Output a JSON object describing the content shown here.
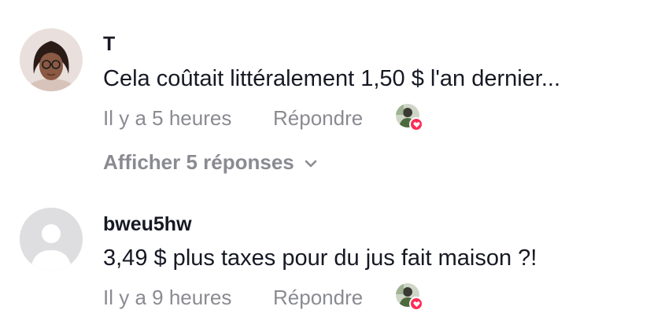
{
  "comments": [
    {
      "username": "T",
      "text": "Cela coûtait littéralement 1,50 $ l'an dernier...",
      "time": "Il y a 5 heures",
      "reply_label": "Répondre",
      "avatar": "photo-avatar",
      "creator_liked": true,
      "view_replies": "Afficher 5 réponses"
    },
    {
      "username": "bweu5hw",
      "text": "3,49 $ plus taxes pour du jus fait maison ?!",
      "time": "Il y a 9 heures",
      "reply_label": "Répondre",
      "avatar": "default-avatar",
      "creator_liked": true
    }
  ],
  "colors": {
    "text_primary": "#161823",
    "text_secondary": "#8a8b91",
    "heart_badge": "#fe2c55",
    "default_avatar_bg": "#dedee0"
  },
  "icons": {
    "heart": "heart-icon",
    "chevron": "chevron-down-icon",
    "default_avatar": "user-silhouette-icon"
  }
}
